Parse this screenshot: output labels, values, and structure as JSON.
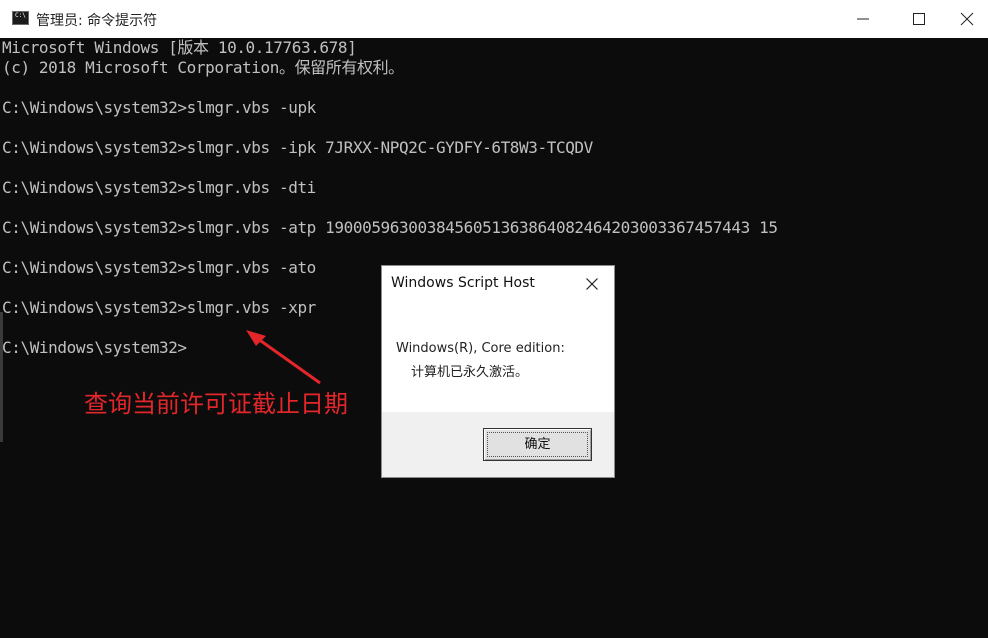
{
  "window": {
    "title": "管理员: 命令提示符",
    "icon_label": "C:\\",
    "icon": "cmd-icon",
    "controls": [
      "minimize-icon",
      "maximize-icon",
      "close-icon"
    ]
  },
  "console": {
    "lines": [
      "Microsoft Windows [版本 10.0.17763.678]",
      "(c) 2018 Microsoft Corporation。保留所有权利。",
      "",
      "C:\\Windows\\system32>slmgr.vbs -upk",
      "",
      "C:\\Windows\\system32>slmgr.vbs -ipk 7JRXX-NPQ2C-GYDFY-6T8W3-TCQDV",
      "",
      "C:\\Windows\\system32>slmgr.vbs -dti",
      "",
      "C:\\Windows\\system32>slmgr.vbs -atp 1900059630038456051363864082464203003367457443 15",
      "",
      "C:\\Windows\\system32>slmgr.vbs -ato",
      "",
      "C:\\Windows\\system32>slmgr.vbs -xpr",
      "",
      "C:\\Windows\\system32>"
    ]
  },
  "annotation": {
    "text": "查询当前许可证截止日期",
    "color": "#e3262a"
  },
  "dialog": {
    "title": "Windows Script Host",
    "message_line1": "Windows(R), Core edition:",
    "message_line2": "计算机已永久激活。",
    "ok_label": "确定"
  }
}
